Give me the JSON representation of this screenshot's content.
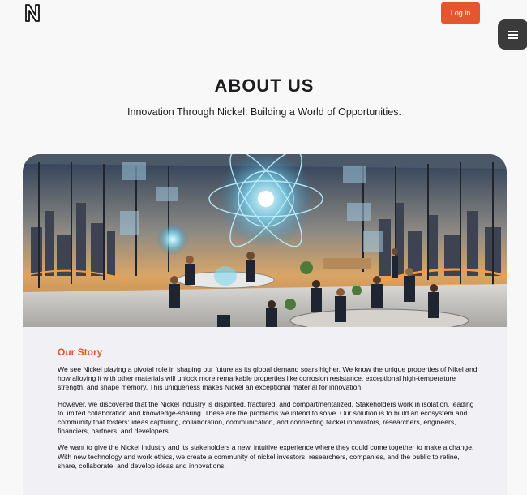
{
  "header": {
    "logo_icon": "nickel-n-logo-icon",
    "login_label": "Log in",
    "menu_icon": "hamburger-menu-icon",
    "accent_color": "#e4572e"
  },
  "hero": {
    "title": "ABOUT US",
    "subtitle": "Innovation Through Nickel: Building a World of Opportunities."
  },
  "story": {
    "heading": "Our Story",
    "paragraphs": [
      "We see Nickel playing a pivotal role in shaping our future as its global demand soars higher. We know the unique properties of Nikel and how alloying it with other materials will unlock more remarkable properties like corrosion resistance, exceptional high-temperature strength, and shape memory. This uniqueness makes Nickel an exceptional material for innovation.",
      "However, we discovered that the Nickel industry is disjointed, fractured, and compartmentalized. Stakeholders work in isolation, leading to limited collaboration and knowledge-sharing. These are the problems we intend to solve. Our solution is to build an ecosystem and community that fosters: ideas capturing, collaboration, communication, and connecting Nickel innovators, researchers, engineers, financiers, partners, and developers.",
      "We want to give the Nickel industry and its stakeholders a new, intuitive experience where they could come together to make a change. With new technology and work ethics, we create a community of nickel investors, researchers, companies, and the public to refine, share, collaborate, and develop ideas and innovations."
    ]
  }
}
